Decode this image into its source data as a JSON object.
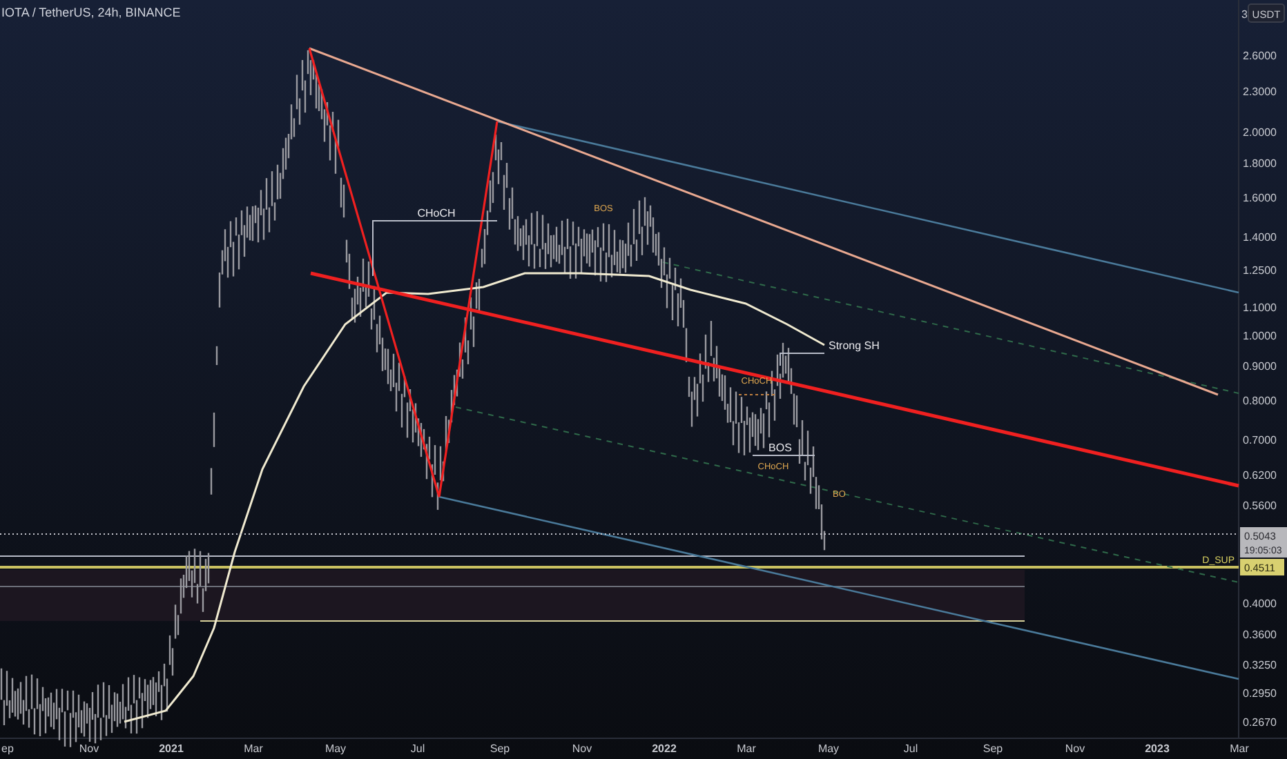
{
  "chart_title": "IOTA / TetherUS, 24h, BINANCE",
  "price_axis": {
    "top_label": "3",
    "unit": "USDT",
    "labels": [
      "2.6000",
      "2.3000",
      "2.0000",
      "1.8000",
      "1.6000",
      "1.4000",
      "1.2500",
      "1.1000",
      "1.0000",
      "0.9000",
      "0.8000",
      "0.7000",
      "0.6200",
      "0.5600",
      "0.4000",
      "0.3600",
      "0.3250",
      "0.2950",
      "0.2670"
    ]
  },
  "current_price": {
    "price": "0.5043",
    "countdown": "19:05:03"
  },
  "level_marker": {
    "label": "D_SUP",
    "price": "0.4511"
  },
  "time_axis": {
    "labels": [
      "ep",
      "Nov",
      "2021",
      "Mar",
      "May",
      "Jul",
      "Sep",
      "Nov",
      "2022",
      "Mar",
      "May",
      "Jul",
      "Sep",
      "Nov",
      "2023",
      "Mar"
    ]
  },
  "annotations": [
    {
      "kind": "structure",
      "text": "CHoCH"
    },
    {
      "kind": "minor",
      "text": "BOS"
    },
    {
      "kind": "structure",
      "text": "Strong SH"
    },
    {
      "kind": "minor",
      "text": "CHoCH"
    },
    {
      "kind": "structure",
      "text": "BOS"
    },
    {
      "kind": "minor",
      "text": "CHoCH"
    },
    {
      "kind": "minor",
      "text": "BO"
    }
  ]
}
